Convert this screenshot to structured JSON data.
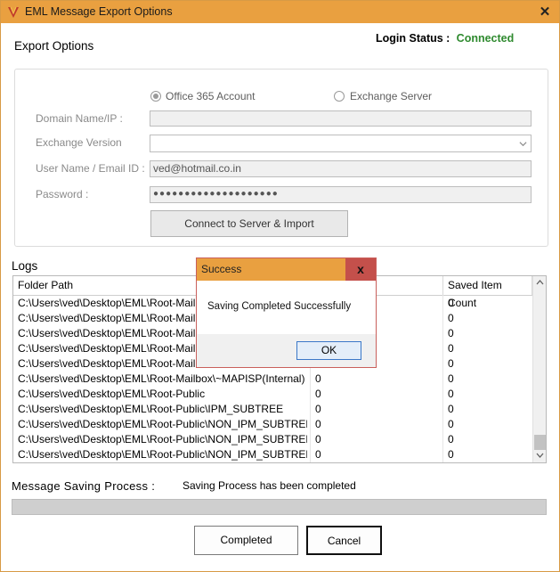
{
  "window": {
    "title": "EML Message Export Options",
    "close_glyph": "✕"
  },
  "export_options": {
    "heading": "Export Options"
  },
  "login": {
    "label": "Login Status :",
    "value": "Connected",
    "value_color": "#2f8a2f"
  },
  "account_type": {
    "options": [
      {
        "label": "Office 365 Account",
        "selected": true
      },
      {
        "label": "Exchange Server",
        "selected": false
      }
    ]
  },
  "form": {
    "domain_label": "Domain Name/IP :",
    "domain_value": "",
    "version_label": "Exchange Version",
    "version_value": "",
    "user_label": "User Name / Email ID :",
    "user_value": "ved@hotmail.co.in",
    "password_label": "Password :",
    "password_value": "●●●●●●●●●●●●●●●●●●●●",
    "connect_button": "Connect to Server & Import"
  },
  "logs": {
    "heading": "Logs",
    "columns": [
      "Folder Path",
      "",
      "Saved Item Count"
    ],
    "rows": [
      {
        "path": "C:\\Users\\ved\\Desktop\\EML\\Root-Mailbo",
        "count1": "",
        "count2": "0"
      },
      {
        "path": "C:\\Users\\ved\\Desktop\\EML\\Root-Mailbo",
        "count1": "",
        "count2": "0"
      },
      {
        "path": "C:\\Users\\ved\\Desktop\\EML\\Root-Mailbo",
        "count1": "",
        "count2": "0"
      },
      {
        "path": "C:\\Users\\ved\\Desktop\\EML\\Root-Mailbo",
        "count1": "",
        "count2": "0"
      },
      {
        "path": "C:\\Users\\ved\\Desktop\\EML\\Root-Mailbo",
        "count1": "",
        "count2": "0"
      },
      {
        "path": "C:\\Users\\ved\\Desktop\\EML\\Root-Mailbox\\~MAPISP(Internal)",
        "count1": "0",
        "count2": "0"
      },
      {
        "path": "C:\\Users\\ved\\Desktop\\EML\\Root-Public",
        "count1": "0",
        "count2": "0"
      },
      {
        "path": "C:\\Users\\ved\\Desktop\\EML\\Root-Public\\IPM_SUBTREE",
        "count1": "0",
        "count2": "0"
      },
      {
        "path": "C:\\Users\\ved\\Desktop\\EML\\Root-Public\\NON_IPM_SUBTREE",
        "count1": "0",
        "count2": "0"
      },
      {
        "path": "C:\\Users\\ved\\Desktop\\EML\\Root-Public\\NON_IPM_SUBTREE\\...",
        "count1": "0",
        "count2": "0"
      },
      {
        "path": "C:\\Users\\ved\\Desktop\\EML\\Root-Public\\NON_IPM_SUBTREE\\...",
        "count1": "0",
        "count2": "0"
      }
    ]
  },
  "status": {
    "label": "Message Saving Process :",
    "value": "Saving Process has been completed",
    "progress": 1.0
  },
  "buttons": {
    "completed": "Completed",
    "cancel": "Cancel"
  },
  "dialog": {
    "title": "Success",
    "close_glyph": "x",
    "message": "Saving Completed Successfully",
    "ok": "OK"
  },
  "icons": {
    "app": "app-logo-icon",
    "dropdown": "chevron-down-icon"
  },
  "colors": {
    "titlebar": "#e9a040",
    "dialog_close": "#c4504b",
    "connected": "#2f8a2f"
  }
}
